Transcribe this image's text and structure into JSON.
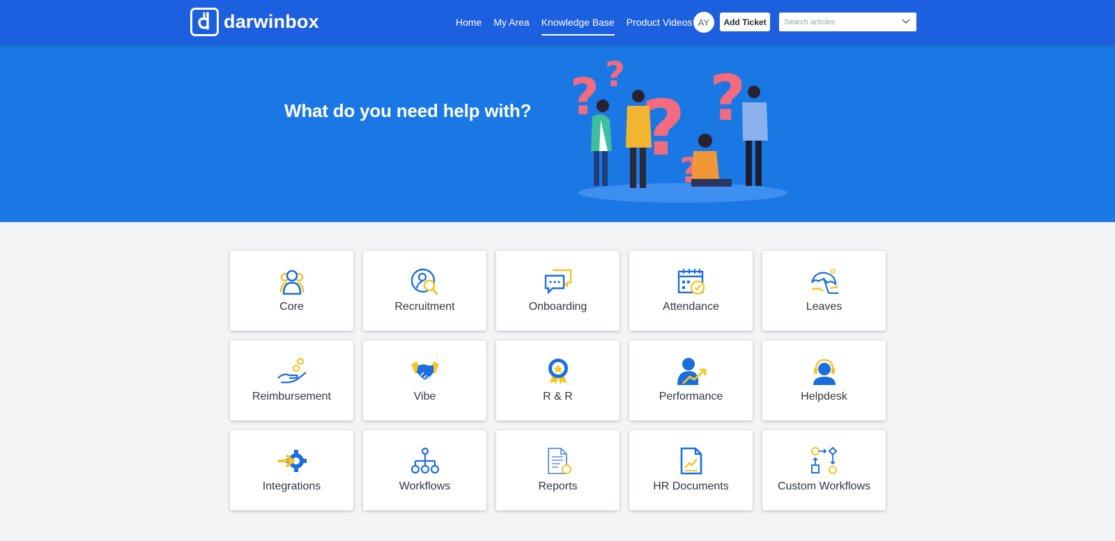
{
  "header": {
    "logo_text": "darwinbox",
    "nav": [
      {
        "label": "Home",
        "active": false
      },
      {
        "label": "My Area",
        "active": false
      },
      {
        "label": "Knowledge Base",
        "active": true
      },
      {
        "label": "Product Videos",
        "active": false
      }
    ],
    "avatar_initials": "AY",
    "add_ticket_label": "Add Ticket",
    "search_placeholder": "Search articles"
  },
  "hero": {
    "title": "What do you need help with?"
  },
  "colors": {
    "header_bg": "#1c5fdf",
    "hero_bg": "#1a78e4",
    "icon_blue": "#1a6ee0",
    "icon_yellow": "#f6c423",
    "page_bg": "#f3f4f6"
  },
  "categories": [
    {
      "label": "Core",
      "icon": "users-icon"
    },
    {
      "label": "Recruitment",
      "icon": "recruitment-search-icon"
    },
    {
      "label": "Onboarding",
      "icon": "chat-bubbles-icon"
    },
    {
      "label": "Attendance",
      "icon": "calendar-check-icon"
    },
    {
      "label": "Leaves",
      "icon": "beach-umbrella-icon"
    },
    {
      "label": "Reimbursement",
      "icon": "hand-coins-icon"
    },
    {
      "label": "Vibe",
      "icon": "handshake-icon"
    },
    {
      "label": "R & R",
      "icon": "award-badge-icon"
    },
    {
      "label": "Performance",
      "icon": "person-growth-icon"
    },
    {
      "label": "Helpdesk",
      "icon": "headset-agent-icon"
    },
    {
      "label": "Integrations",
      "icon": "gear-arrow-icon"
    },
    {
      "label": "Workflows",
      "icon": "hierarchy-icon"
    },
    {
      "label": "Reports",
      "icon": "report-document-icon"
    },
    {
      "label": "HR Documents",
      "icon": "chart-document-icon"
    },
    {
      "label": "Custom Workflows",
      "icon": "flowchart-icon"
    }
  ]
}
